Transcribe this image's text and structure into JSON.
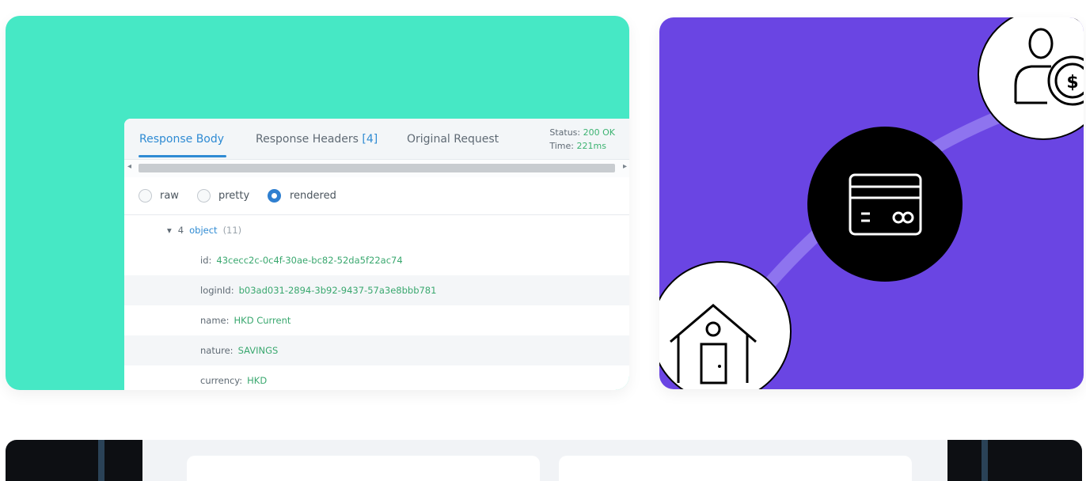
{
  "response_panel": {
    "tabs": {
      "body": "Response Body",
      "headers": "Response Headers",
      "headers_count": "[4]",
      "original": "Original Request"
    },
    "status_label": "Status:",
    "status_value": "200 OK",
    "time_label": "Time:",
    "time_value": "221ms",
    "scroll_left": "◂",
    "scroll_right": "▸",
    "view_modes": [
      "raw",
      "pretty",
      "rendered"
    ],
    "selected_view_mode": "rendered",
    "tree": {
      "toggle": "▾",
      "index": "4",
      "type": "object",
      "count": "(11)",
      "fields": [
        {
          "key": "id:",
          "value": "43cecc2c-0c4f-30ae-bc82-52da5f22ac74"
        },
        {
          "key": "loginId:",
          "value": "b03ad031-2894-3b92-9437-57a3e8bbb781"
        },
        {
          "key": "name:",
          "value": "HKD Current"
        },
        {
          "key": "nature:",
          "value": "SAVINGS"
        },
        {
          "key": "currency:",
          "value": "HKD"
        }
      ]
    }
  },
  "illustration": {
    "icons": [
      "house-icon",
      "credit-card-icon",
      "person-coin-icon"
    ]
  },
  "colors": {
    "teal": "#46e8c5",
    "purple": "#6a45e3",
    "accent_blue": "#2f8bd3",
    "value_green": "#3aa86f"
  }
}
